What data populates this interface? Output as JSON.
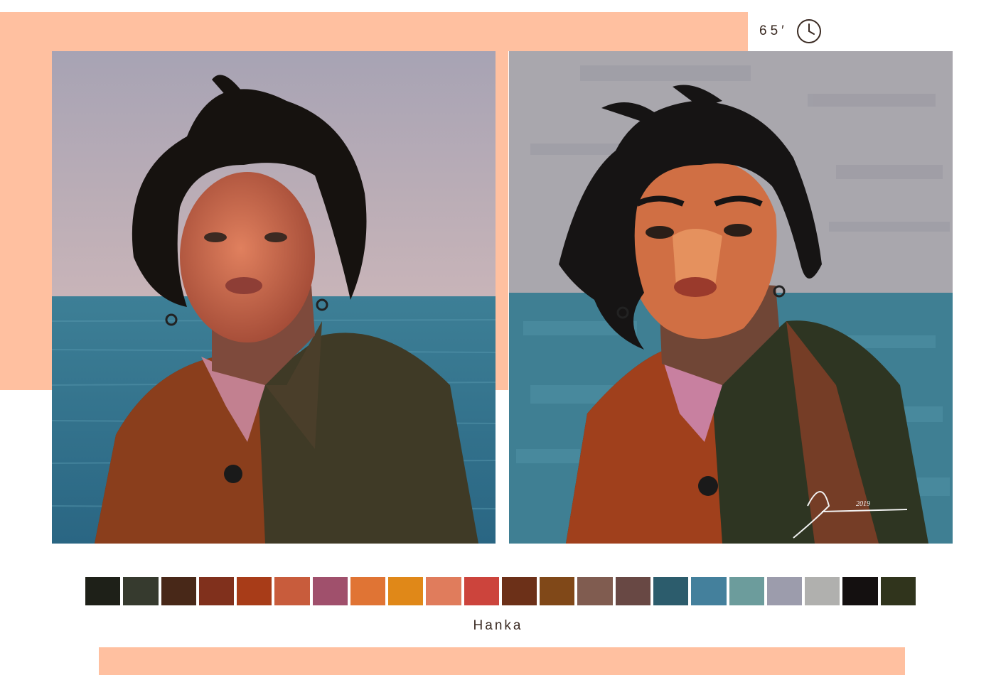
{
  "timer": {
    "label": "65′",
    "icon": "clock-icon"
  },
  "reference_photo": {
    "icon": "portrait-photo"
  },
  "painting": {
    "icon": "digital-painting",
    "signature_year": "2019"
  },
  "palette": {
    "swatches": [
      "#1e2018",
      "#363a2e",
      "#482818",
      "#80301c",
      "#a83c18",
      "#c85c3c",
      "#a0506c",
      "#e07434",
      "#e08818",
      "#e07c5c",
      "#cc443c",
      "#6c3018",
      "#804818",
      "#805c50",
      "#684844",
      "#2c5c6c",
      "#44809c",
      "#6c9c9c",
      "#9c9cac",
      "#b0b0ae",
      "#141010",
      "#30341c"
    ]
  },
  "caption": "Hanka",
  "colors": {
    "accent": "#ffc0a0",
    "text": "#3a2a22"
  }
}
